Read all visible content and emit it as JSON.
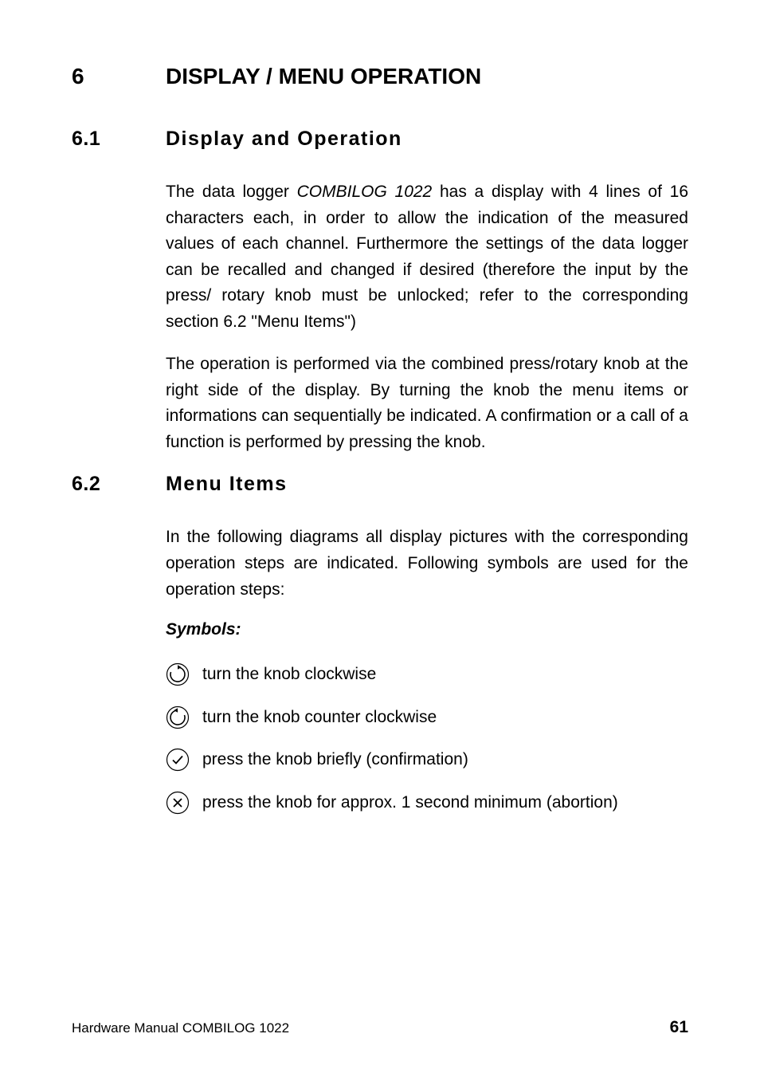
{
  "h1": {
    "num": "6",
    "title": "DISPLAY / MENU OPERATION"
  },
  "s61": {
    "num": "6.1",
    "title": "Display and Operation",
    "p1a": "The data logger ",
    "p1_em": "COMBILOG 1022",
    "p1b": " has a display with 4 lines of 16 characters each, in order to allow the indication of the measured values of each channel. Furthermore the settings of the data logger can be recalled and changed if desired (therefore the input by the press/ rotary knob must be unlocked; refer to the corresponding section 6.2 \"Menu Items\")",
    "p2": "The operation is performed via the combined press/rotary knob at the right side of the display. By turning the knob the menu items or informations can sequentially be indicated. A confirmation or a call of a function is performed by pressing the knob."
  },
  "s62": {
    "num": "6.2",
    "title": "Menu Items",
    "intro": "In the following diagrams all display pictures with the corresponding operation steps are indicated. Following symbols are used for the operation steps:",
    "symbols_label": "Symbols:",
    "items": [
      "turn the knob clockwise",
      "turn the knob counter clockwise",
      "press the knob briefly (confirmation)",
      "press the knob for approx. 1 second minimum (abortion)"
    ]
  },
  "footer": {
    "left": "Hardware Manual COMBILOG 1022",
    "right": "61"
  }
}
